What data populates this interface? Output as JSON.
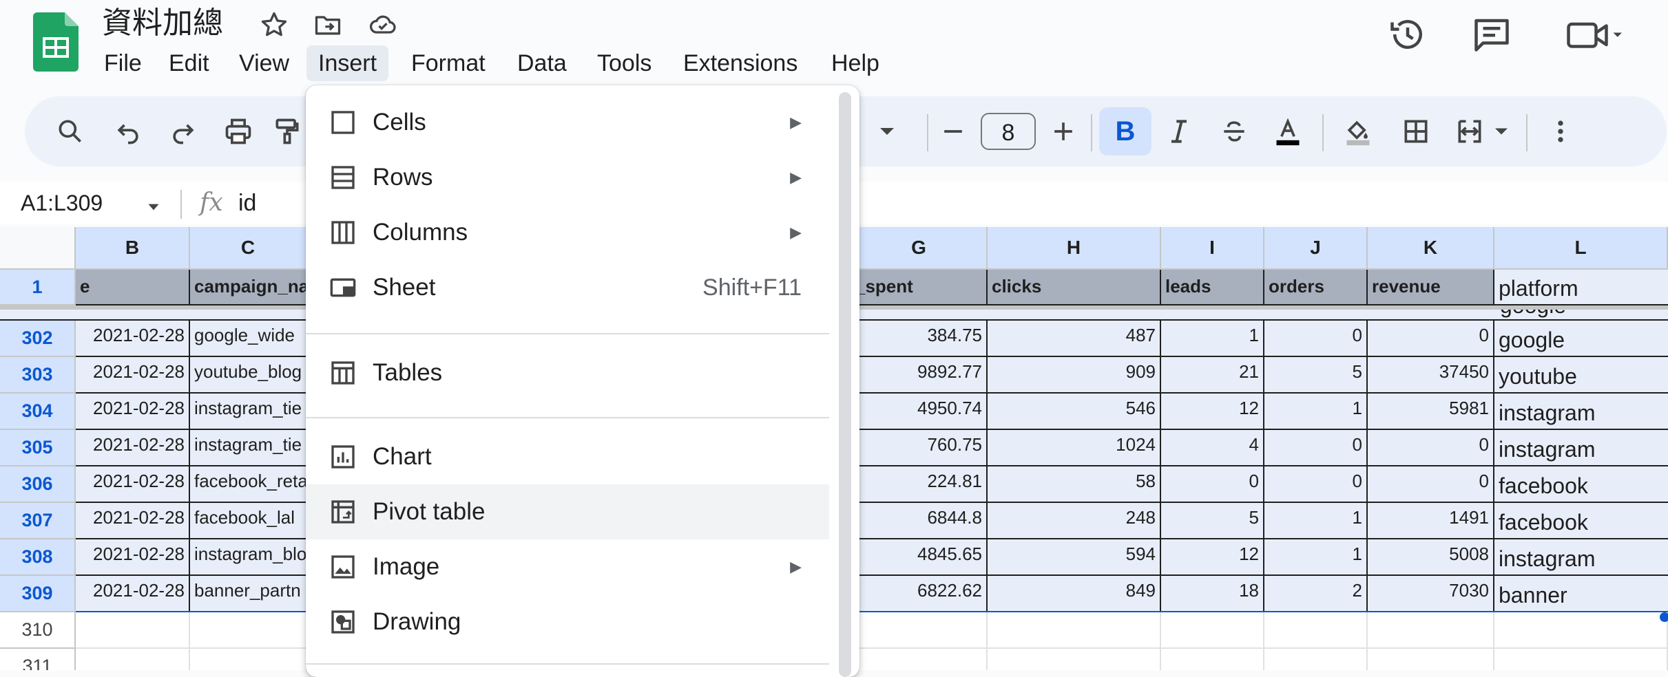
{
  "app": {
    "doc_title": "資料加總",
    "menu": [
      "File",
      "Edit",
      "View",
      "Insert",
      "Format",
      "Data",
      "Tools",
      "Extensions",
      "Help"
    ],
    "active_menu": "Insert"
  },
  "toolbar": {
    "font_size": "8",
    "bold_label": "B"
  },
  "formula_bar": {
    "name_box": "A1:L309",
    "fx_label": "fx",
    "value": "id"
  },
  "grid": {
    "column_headers": [
      "B",
      "C",
      "G",
      "H",
      "I",
      "J",
      "K",
      "L"
    ],
    "header_row": {
      "row_number": "1",
      "b": "e",
      "c": "campaign_na",
      "g": "_spent",
      "h": "clicks",
      "i": "leads",
      "j": "orders",
      "k": "revenue",
      "l": "platform"
    },
    "partial_platform": "google",
    "rows": [
      {
        "n": "302",
        "date": "2021-02-28",
        "campaign": "google_wide",
        "spent": "384.75",
        "clicks": "487",
        "leads": "1",
        "orders": "0",
        "revenue": "0",
        "platform": "google"
      },
      {
        "n": "303",
        "date": "2021-02-28",
        "campaign": "youtube_blog",
        "spent": "9892.77",
        "clicks": "909",
        "leads": "21",
        "orders": "5",
        "revenue": "37450",
        "platform": "youtube"
      },
      {
        "n": "304",
        "date": "2021-02-28",
        "campaign": "instagram_tie",
        "spent": "4950.74",
        "clicks": "546",
        "leads": "12",
        "orders": "1",
        "revenue": "5981",
        "platform": "instagram"
      },
      {
        "n": "305",
        "date": "2021-02-28",
        "campaign": "instagram_tie",
        "spent": "760.75",
        "clicks": "1024",
        "leads": "4",
        "orders": "0",
        "revenue": "0",
        "platform": "instagram"
      },
      {
        "n": "306",
        "date": "2021-02-28",
        "campaign": "facebook_reta",
        "spent": "224.81",
        "clicks": "58",
        "leads": "0",
        "orders": "0",
        "revenue": "0",
        "platform": "facebook"
      },
      {
        "n": "307",
        "date": "2021-02-28",
        "campaign": "facebook_lal",
        "spent": "6844.8",
        "clicks": "248",
        "leads": "5",
        "orders": "1",
        "revenue": "1491",
        "platform": "facebook"
      },
      {
        "n": "308",
        "date": "2021-02-28",
        "campaign": "instagram_blo",
        "spent": "4845.65",
        "clicks": "594",
        "leads": "12",
        "orders": "1",
        "revenue": "5008",
        "platform": "instagram"
      },
      {
        "n": "309",
        "date": "2021-02-28",
        "campaign": "banner_partn",
        "spent": "6822.62",
        "clicks": "849",
        "leads": "18",
        "orders": "2",
        "revenue": "7030",
        "platform": "banner"
      }
    ],
    "empty_rows": [
      "310",
      "311"
    ]
  },
  "insert_menu": {
    "items": [
      {
        "label": "Cells",
        "icon": "cells-icon",
        "submenu": true
      },
      {
        "label": "Rows",
        "icon": "rows-icon",
        "submenu": true
      },
      {
        "label": "Columns",
        "icon": "columns-icon",
        "submenu": true
      },
      {
        "label": "Sheet",
        "icon": "sheet-icon",
        "shortcut": "Shift+F11"
      },
      {
        "label": "Tables",
        "icon": "tables-icon"
      },
      {
        "label": "Chart",
        "icon": "chart-icon"
      },
      {
        "label": "Pivot table",
        "icon": "pivot-table-icon",
        "highlighted": true
      },
      {
        "label": "Image",
        "icon": "image-icon",
        "submenu": true
      },
      {
        "label": "Drawing",
        "icon": "drawing-icon"
      }
    ],
    "submenu_arrow": "▶"
  },
  "colors": {
    "accent": "#0b57d0",
    "selection": "#d3e3fd",
    "toolbar_bg": "#edf2fa",
    "sheets_green": "#0f9d58"
  }
}
